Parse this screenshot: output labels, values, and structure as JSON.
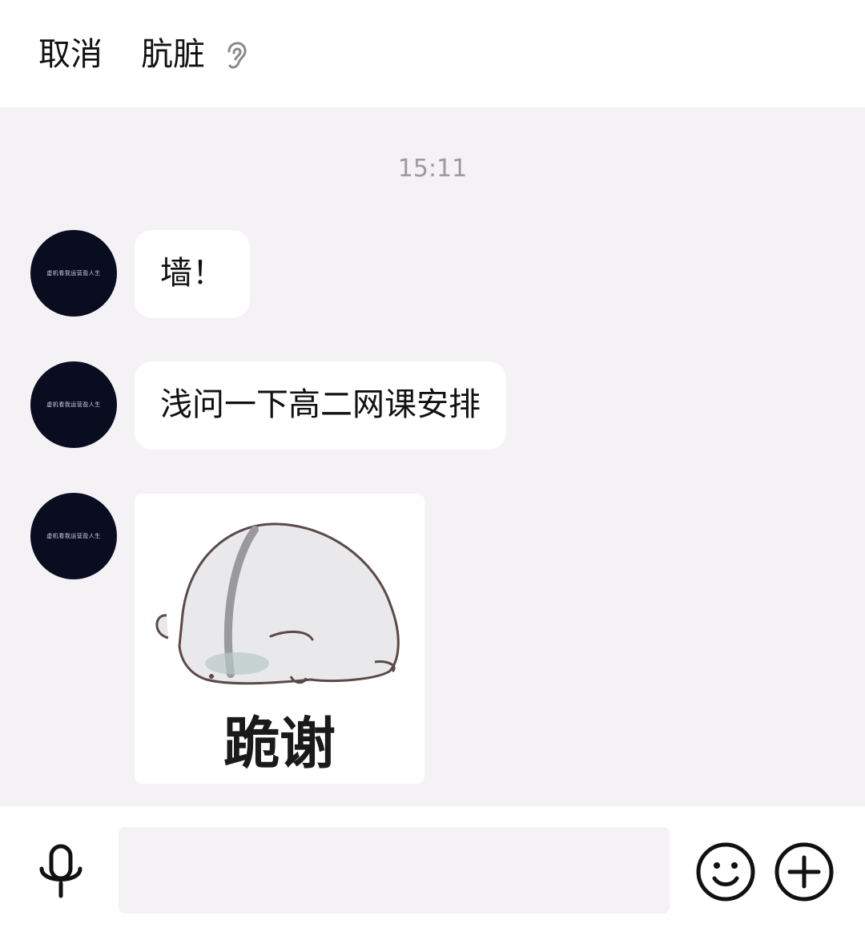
{
  "header": {
    "cancel_label": "取消",
    "title": "肮脏",
    "mode_icon": "ear-icon"
  },
  "conversation": {
    "timestamp": "15:11",
    "avatar_text": "虚机看我运营盈人生",
    "messages": [
      {
        "type": "text",
        "text": "墙！"
      },
      {
        "type": "text",
        "text": "浅问一下高二网课安排"
      },
      {
        "type": "sticker",
        "caption": "跪谢",
        "icon": "hamster-sticker"
      }
    ]
  },
  "input_bar": {
    "voice_icon": "microphone-icon",
    "text_value": "",
    "emoji_icon": "smiley-icon",
    "more_icon": "plus-icon"
  }
}
